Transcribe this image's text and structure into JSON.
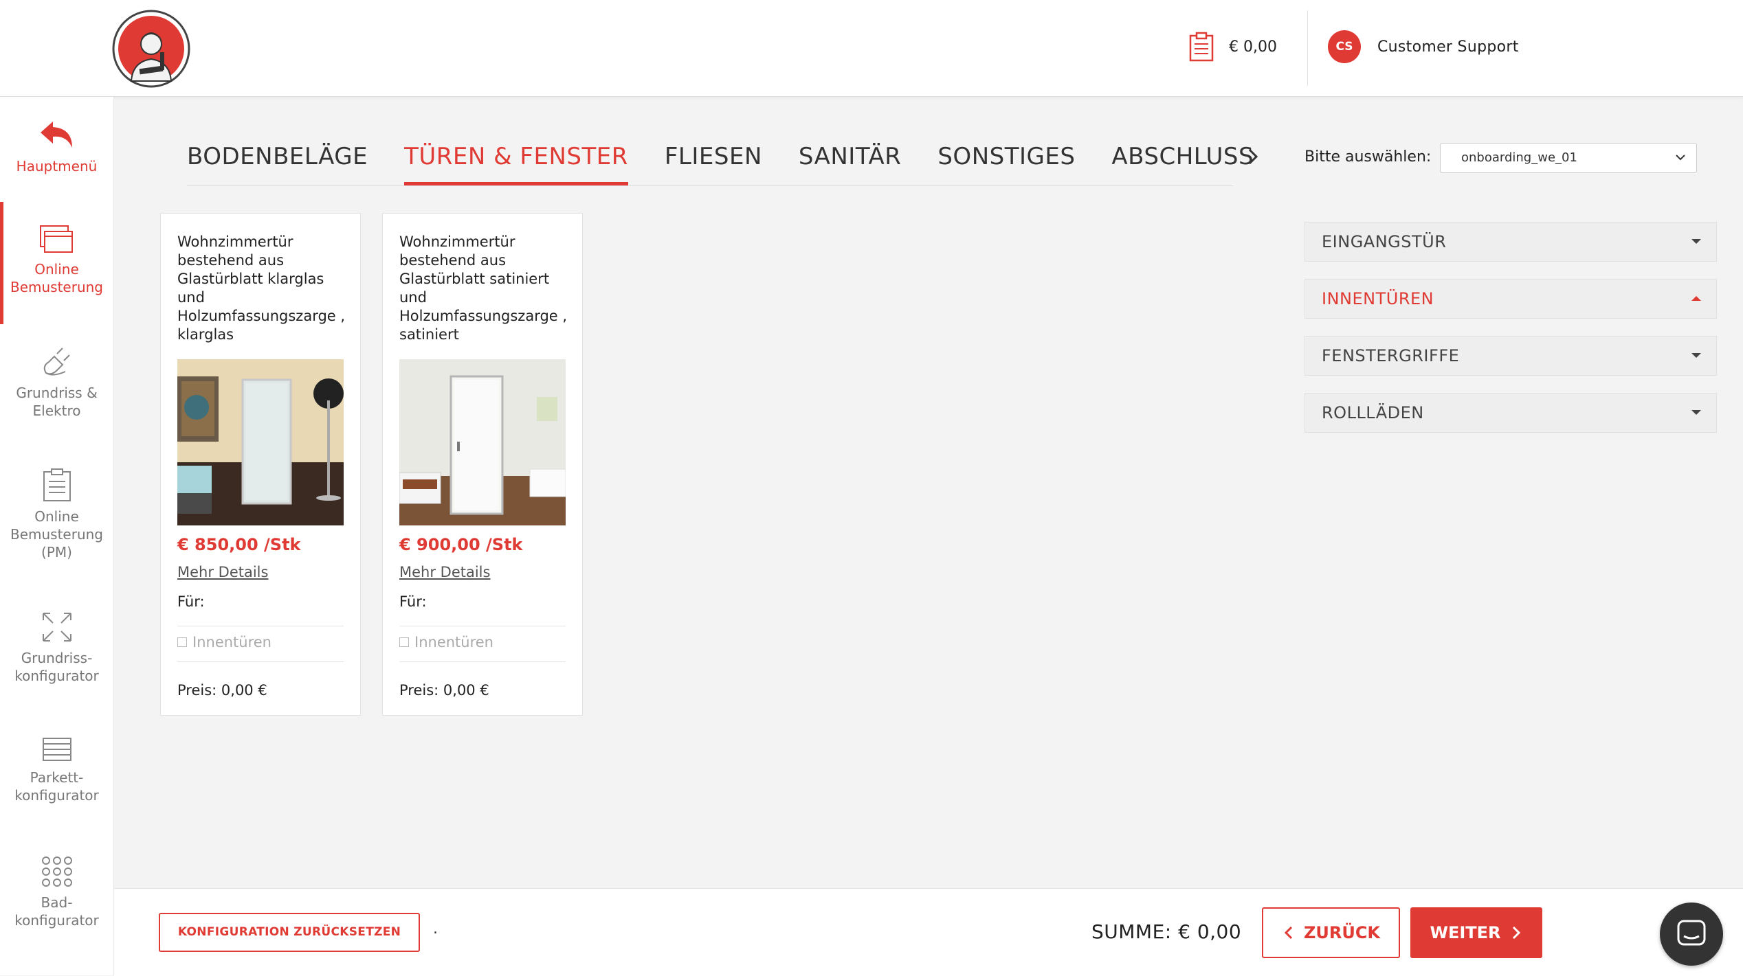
{
  "header": {
    "cart_amount": "€ 0,00",
    "user_initials": "CS",
    "user_name": "Customer Support"
  },
  "sidebar": {
    "items": [
      {
        "label": "Hauptmenü",
        "icon": "back-arrow-icon"
      },
      {
        "label": "Online Bemusterung",
        "icon": "windows-icon"
      },
      {
        "label": "Grundriss & Elektro",
        "icon": "plug-icon"
      },
      {
        "label": "Online Bemusterung (PM)",
        "icon": "clipboard-icon"
      },
      {
        "label": "Grundriss-konfigurator",
        "icon": "expand-icon"
      },
      {
        "label": "Parkett-konfigurator",
        "icon": "parquet-icon"
      },
      {
        "label": "Bad-konfigurator",
        "icon": "dots-grid-icon"
      }
    ]
  },
  "tabs": [
    {
      "label": "BODENBELÄGE",
      "active": false
    },
    {
      "label": "TÜREN & FENSTER",
      "active": true
    },
    {
      "label": "FLIESEN",
      "active": false
    },
    {
      "label": "SANITÄR",
      "active": false
    },
    {
      "label": "SONSTIGES",
      "active": false
    },
    {
      "label": "ABSCHLUSS",
      "active": false
    }
  ],
  "select": {
    "label": "Bitte auswählen:",
    "value": "onboarding_we_01"
  },
  "accordion": [
    {
      "label": "EINGANGSTÜR",
      "open": false
    },
    {
      "label": "INNENTÜREN",
      "open": true
    },
    {
      "label": "FENSTERGRIFFE",
      "open": false
    },
    {
      "label": "ROLLLÄDEN",
      "open": false
    }
  ],
  "products": [
    {
      "title": "Wohnzimmertür bestehend aus Glastürblatt klarglas und Holzumfassungszarge , klarglas",
      "price": "€ 850,00 /Stk",
      "details_link": "Mehr Details",
      "for_label": "Für:",
      "checkbox_label": "Innentüren",
      "price_line": "Preis: 0,00 €"
    },
    {
      "title": "Wohnzimmertür bestehend aus Glastürblatt satiniert und Holzumfassungszarge , satiniert",
      "price": "€ 900,00 /Stk",
      "details_link": "Mehr Details",
      "for_label": "Für:",
      "checkbox_label": "Innentüren",
      "price_line": "Preis: 0,00 €"
    }
  ],
  "footer": {
    "reset_label": "KONFIGURATION ZURÜCKSETZEN",
    "dot": ".",
    "sum_label": "SUMME: € 0,00",
    "back_label": "ZURÜCK",
    "next_label": "WEITER"
  },
  "colors": {
    "accent": "#e03a34",
    "background": "#f3f3f3"
  }
}
